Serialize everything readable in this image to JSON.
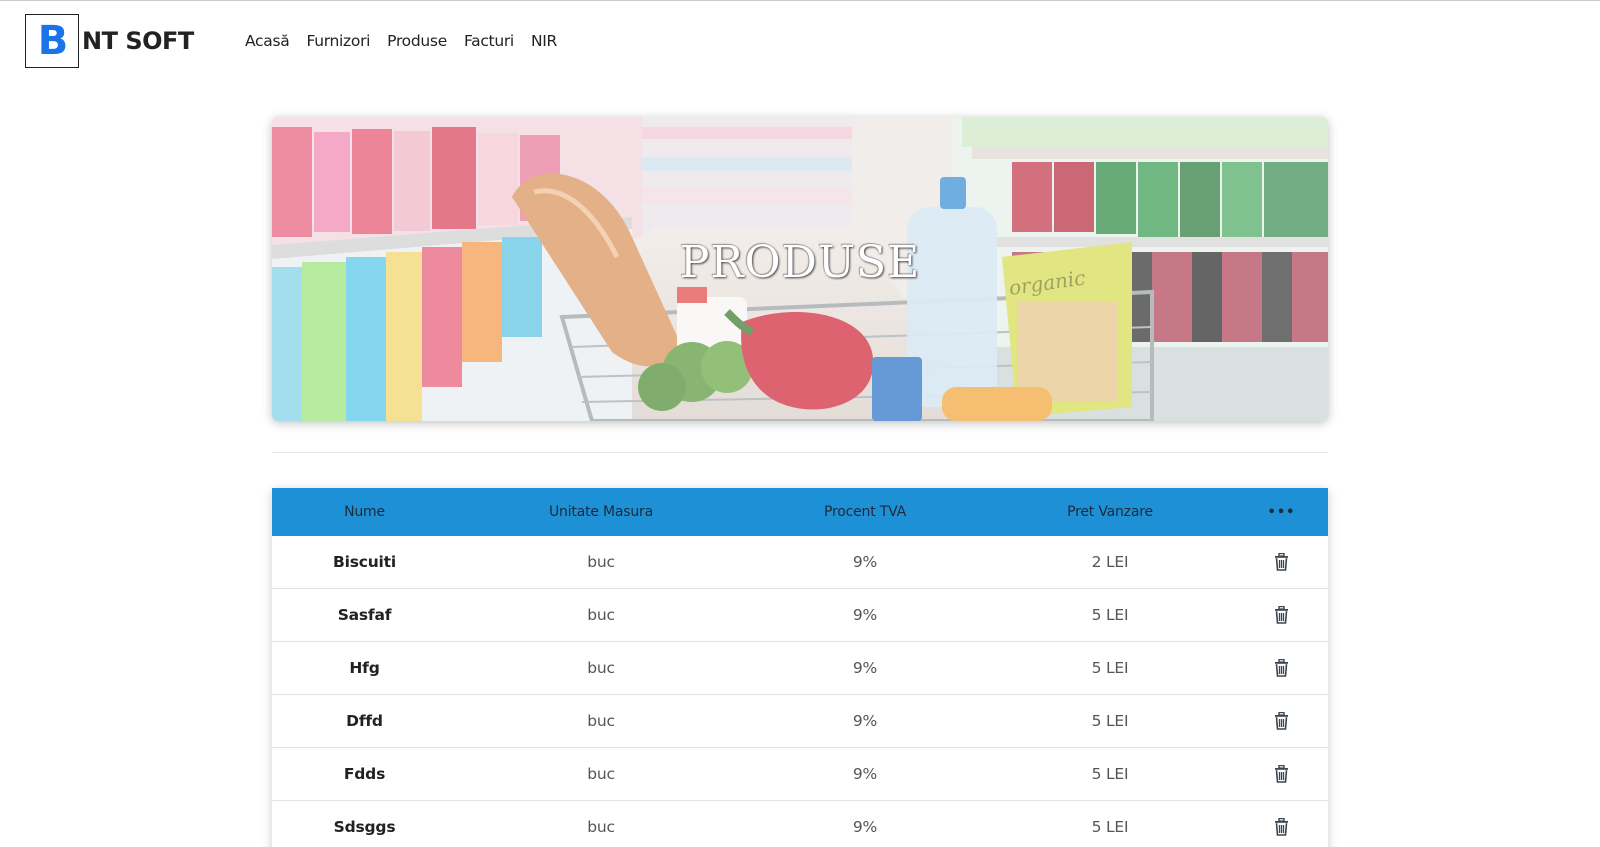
{
  "header": {
    "logo_letter": "B",
    "logo_text": "NT SOFT",
    "brand_color": "#1a73e8",
    "nav": [
      {
        "label": "Acasă"
      },
      {
        "label": "Furnizori"
      },
      {
        "label": "Produse"
      },
      {
        "label": "Facturi"
      },
      {
        "label": "NIR"
      }
    ]
  },
  "hero": {
    "title": "PRODUSE",
    "image_text": "organic"
  },
  "table": {
    "header_color": "#1e90d6",
    "columns": [
      "Nume",
      "Unitate Masura",
      "Procent TVA",
      "Pret Vanzare",
      "•••"
    ],
    "actions_icon": "more-horizontal-icon",
    "row_action_icon": "trash-icon",
    "rows": [
      {
        "name": "Biscuiti",
        "unit": "buc",
        "vat": "9%",
        "price": "2 LEI"
      },
      {
        "name": "Sasfaf",
        "unit": "buc",
        "vat": "9%",
        "price": "5 LEI"
      },
      {
        "name": "Hfg",
        "unit": "buc",
        "vat": "9%",
        "price": "5 LEI"
      },
      {
        "name": "Dffd",
        "unit": "buc",
        "vat": "9%",
        "price": "5 LEI"
      },
      {
        "name": "Fdds",
        "unit": "buc",
        "vat": "9%",
        "price": "5 LEI"
      },
      {
        "name": "Sdsggs",
        "unit": "buc",
        "vat": "9%",
        "price": "5 LEI"
      }
    ]
  }
}
